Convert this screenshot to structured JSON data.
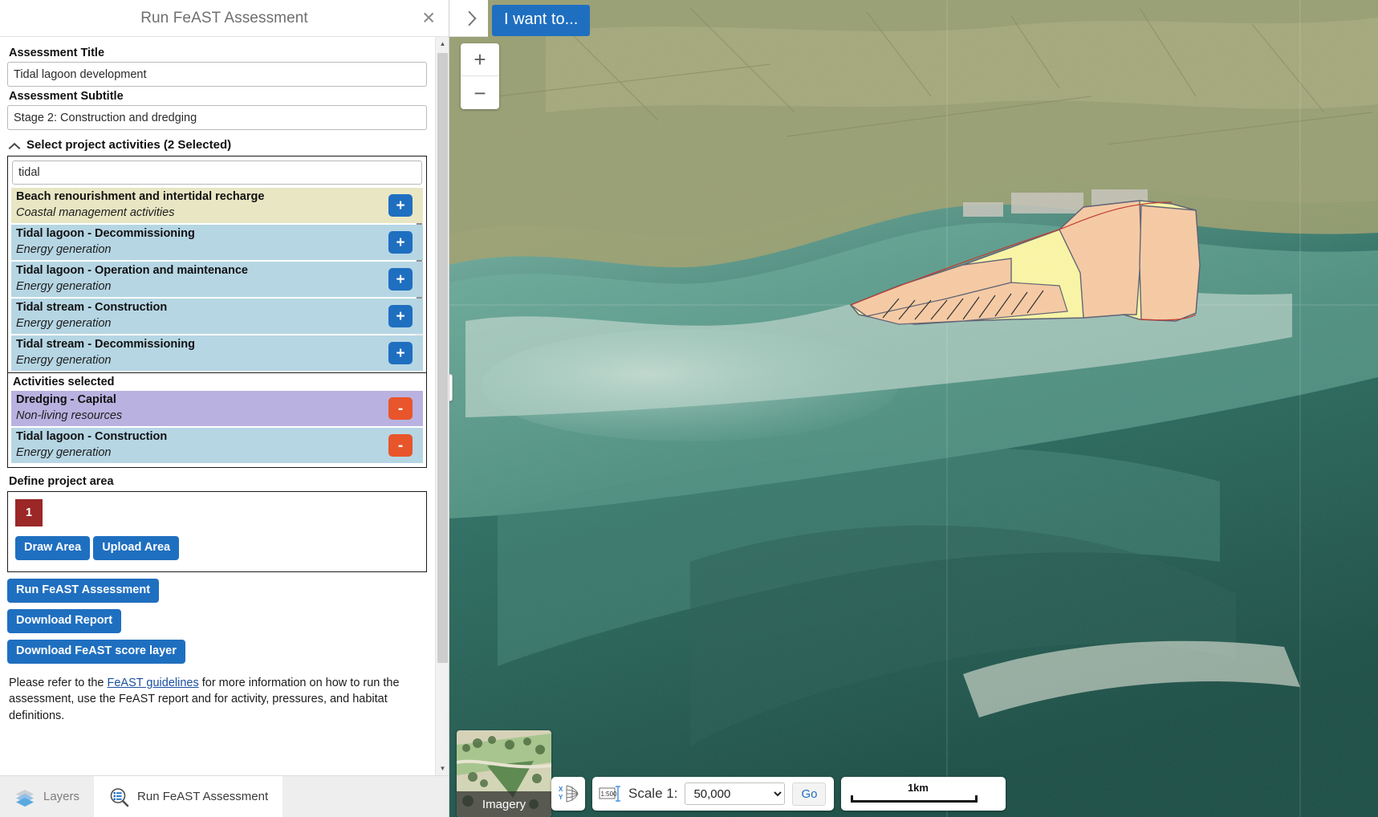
{
  "panel": {
    "title": "Run FeAST Assessment",
    "close_icon": "close-icon",
    "assessment_title_label": "Assessment Title",
    "assessment_title_value": "Tidal lagoon development",
    "assessment_subtitle_label": "Assessment Subtitle",
    "assessment_subtitle_value": "Stage 2: Construction and dredging",
    "activities_toggle_label": "Select project activities (2 Selected)",
    "search_value": "tidal",
    "available_activities": [
      {
        "name": "Beach renourishment and intertidal recharge",
        "category": "Coastal management activities",
        "color": "#e8e6c3",
        "action": "+"
      },
      {
        "name": "Tidal lagoon - Decommissioning",
        "category": "Energy generation",
        "color": "#b6d6e4",
        "action": "+"
      },
      {
        "name": "Tidal lagoon - Operation and maintenance",
        "category": "Energy generation",
        "color": "#b6d6e4",
        "action": "+"
      },
      {
        "name": "Tidal stream - Construction",
        "category": "Energy generation",
        "color": "#b6d6e4",
        "action": "+"
      },
      {
        "name": "Tidal stream - Decommissioning",
        "category": "Energy generation",
        "color": "#b6d6e4",
        "action": "+"
      }
    ],
    "selected_heading": "Activities selected",
    "selected_activities": [
      {
        "name": "Dredging - Capital",
        "category": "Non-living resources",
        "color": "#b9b2e0",
        "action": "-"
      },
      {
        "name": "Tidal lagoon - Construction",
        "category": "Energy generation",
        "color": "#b6d6e4",
        "action": "-"
      }
    ],
    "define_area_label": "Define project area",
    "area_count": "1",
    "draw_area_label": "Draw Area",
    "upload_area_label": "Upload Area",
    "run_assessment_label": "Run FeAST Assessment",
    "download_report_label": "Download Report",
    "download_score_layer_label": "Download FeAST score layer",
    "helper_prefix": "Please refer to the ",
    "helper_link": "FeAST guidelines",
    "helper_suffix": " for more information on how to run the assessment, use the FeAST report and for activity, pressures, and habitat definitions.",
    "tabs": [
      {
        "label": "Layers",
        "icon": "layers-icon",
        "active": false
      },
      {
        "label": "Run FeAST Assessment",
        "icon": "search-list-icon",
        "active": true
      }
    ]
  },
  "map": {
    "collapse_icon": "chevron-left-icon",
    "i_want_to_label": "I want to...",
    "zoom_in_label": "+",
    "zoom_out_label": "−",
    "basemap_label": "Imagery",
    "xy_icon": "xy-coordinates-icon",
    "scale_icon": "scale-ratio-icon",
    "scale_label": "Scale 1:",
    "scale_value": "50,000",
    "scale_options": [
      "50,000"
    ],
    "go_label": "Go",
    "scalebar_label": "1km",
    "accent_color": "#1f6fc0",
    "overlay_colors": {
      "yellow": "#fbf6a5",
      "peach": "#f7cba4",
      "outline": "#5e6273"
    }
  }
}
